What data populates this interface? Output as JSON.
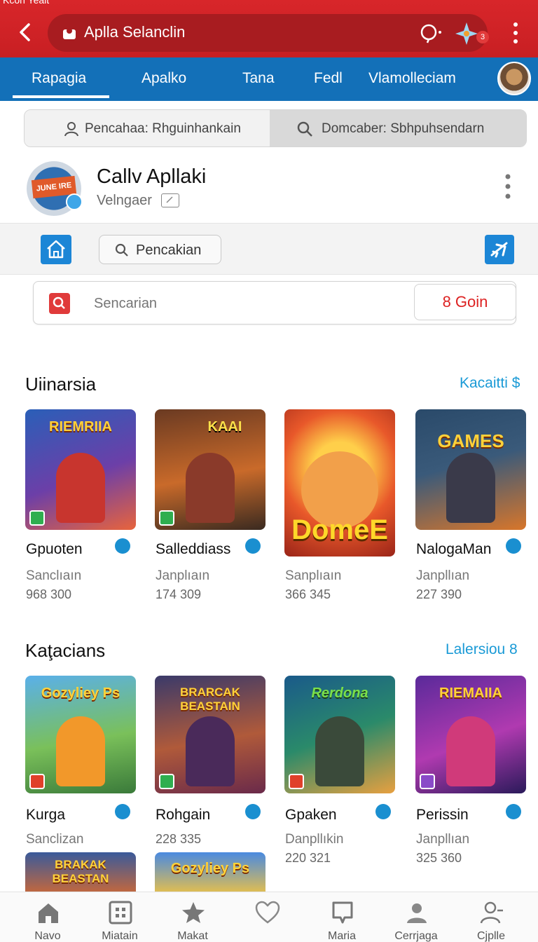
{
  "browser": {
    "status_text": "Kcon Yealt",
    "address_text": "Aplla Selanclin",
    "extension_badge": "3"
  },
  "tabs": [
    {
      "label": "Rapagia",
      "active": true
    },
    {
      "label": "Apalko"
    },
    {
      "label": "Tana"
    },
    {
      "label": "Fedl"
    },
    {
      "label": "Vlamolleciam"
    }
  ],
  "segmented_search": {
    "left": "Pencahaa: Rhguinhankain",
    "right": "Domcaber: Sbhpuhsendarn"
  },
  "app": {
    "logo_text": "JUNE IRE",
    "name": "Callv Apllaki",
    "subtitle": "Velngaer"
  },
  "toolbar": {
    "search_pill": "Pencakian"
  },
  "search": {
    "placeholder": "Sencarian",
    "go_label": "8 Goin"
  },
  "sections": [
    {
      "title": "Uiinarsia",
      "link": "Kacaitti $",
      "cards": [
        {
          "name": "Gpuoten",
          "sub": "Sanclıaın",
          "count": "968 300",
          "art": "RIEMRIIA"
        },
        {
          "name": "Salleddiass",
          "sub": "Janplıaın",
          "count": "174 309",
          "art": "KAAI"
        },
        {
          "name": "",
          "sub": "Sanplıaın",
          "count": "366 345",
          "art": "DomeE"
        },
        {
          "name": "NalogaMan",
          "sub": "Janpllıan",
          "count": "227 390",
          "art": "GAMES"
        }
      ]
    },
    {
      "title": "Kaţacians",
      "link": "Lalersiou 8",
      "cards": [
        {
          "name": "Kurga",
          "sub": "Sanclizan",
          "count": "",
          "art": "Gozyliey Ps"
        },
        {
          "name": "Rohgain",
          "sub": "",
          "count": "228 335",
          "art": "BRARCAK BEASTAIN"
        },
        {
          "name": "Gpaken",
          "sub": "Danpllıkin",
          "count": "220 321",
          "art": "Rerdona"
        },
        {
          "name": "Perissin",
          "sub": "Janpllıan",
          "count": "325 360",
          "art": "RIEMAIIA"
        }
      ]
    }
  ],
  "partial_cards": [
    "BRAKAK BEASTAN",
    "Gozyliey Ps"
  ],
  "bottom_nav": [
    {
      "label": "Navo",
      "icon": "home-icon"
    },
    {
      "label": "Miatain",
      "icon": "grid-icon"
    },
    {
      "label": "Makat",
      "icon": "star-icon"
    },
    {
      "label": "",
      "icon": "heart-icon"
    },
    {
      "label": "Maria",
      "icon": "chat-icon"
    },
    {
      "label": "Cerrjaga",
      "icon": "person-icon"
    },
    {
      "label": "Cjplle",
      "icon": "profile-icon"
    }
  ],
  "colors": {
    "top_bar": "#d8262a",
    "tab_bar": "#1370b8",
    "accent_blue": "#1a9ad6",
    "go_red": "#dd2222"
  }
}
